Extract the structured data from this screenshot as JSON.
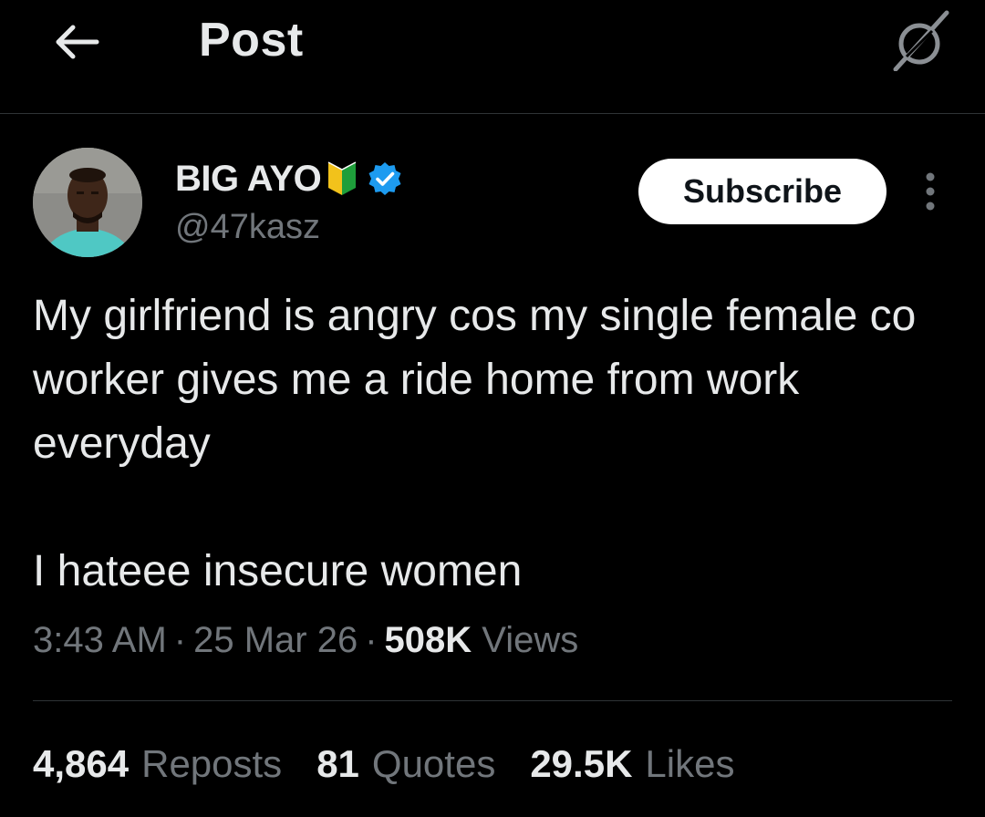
{
  "header": {
    "title": "Post",
    "back_icon": "arrow-left-icon",
    "grok_icon": "grok-icon"
  },
  "author": {
    "name": "BIG AYO",
    "name_emoji": "japanese-beginner-symbol-icon",
    "verified": "verified-badge-icon",
    "handle": "@47kasz"
  },
  "actions": {
    "subscribe_label": "Subscribe",
    "more_icon": "more-vertical-icon"
  },
  "tweet": {
    "text": "My girlfriend is angry cos my single female co worker gives me a ride home from work everyday\n\nI hateee insecure women",
    "time": "3:43 AM",
    "separator": "·",
    "date": "25 Mar 26",
    "views_count": "508K",
    "views_label": "Views"
  },
  "stats": [
    {
      "count": "4,864",
      "label": "Reposts"
    },
    {
      "count": "81",
      "label": "Quotes"
    },
    {
      "count": "29.5K",
      "label": "Likes"
    }
  ],
  "colors": {
    "background": "#000000",
    "text_primary": "#e7e9ea",
    "text_secondary": "#71767b",
    "verified_blue": "#1d9bf0",
    "divider": "#2f3336"
  }
}
